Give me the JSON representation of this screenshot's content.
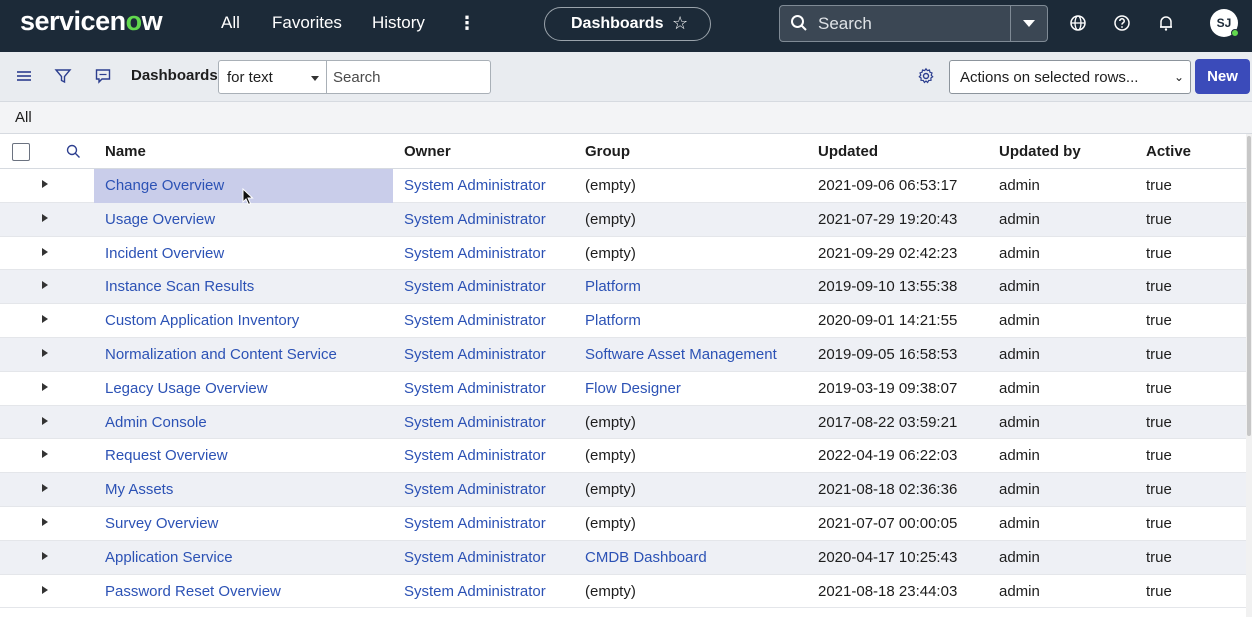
{
  "topnav": {
    "logo_pre": "servicen",
    "logo_o": "o",
    "logo_post": "w",
    "links": [
      "All",
      "Favorites",
      "History"
    ],
    "context_title": "Dashboards",
    "search_placeholder": "Search",
    "avatar_initials": "SJ"
  },
  "toolbar": {
    "list_title": "Dashboards",
    "search_field": "for text",
    "search_placeholder": "Search",
    "actions_label": "Actions on selected rows...",
    "new_label": "New"
  },
  "breadcrumb": "All",
  "table": {
    "columns": [
      "Name",
      "Owner",
      "Group",
      "Updated",
      "Updated by",
      "Active"
    ],
    "rows": [
      {
        "name": "Change Overview",
        "owner": "System Administrator",
        "group": "(empty)",
        "updated": "2021-09-06 06:53:17",
        "updated_by": "admin",
        "active": "true"
      },
      {
        "name": "Usage Overview",
        "owner": "System Administrator",
        "group": "(empty)",
        "updated": "2021-07-29 19:20:43",
        "updated_by": "admin",
        "active": "true"
      },
      {
        "name": "Incident Overview",
        "owner": "System Administrator",
        "group": "(empty)",
        "updated": "2021-09-29 02:42:23",
        "updated_by": "admin",
        "active": "true"
      },
      {
        "name": "Instance Scan Results",
        "owner": "System Administrator",
        "group": "Platform",
        "updated": "2019-09-10 13:55:38",
        "updated_by": "admin",
        "active": "true"
      },
      {
        "name": "Custom Application Inventory",
        "owner": "System Administrator",
        "group": "Platform",
        "updated": "2020-09-01 14:21:55",
        "updated_by": "admin",
        "active": "true"
      },
      {
        "name": "Normalization and Content Service",
        "owner": "System Administrator",
        "group": "Software Asset Management",
        "updated": "2019-09-05 16:58:53",
        "updated_by": "admin",
        "active": "true"
      },
      {
        "name": "Legacy Usage Overview",
        "owner": "System Administrator",
        "group": "Flow Designer",
        "updated": "2019-03-19 09:38:07",
        "updated_by": "admin",
        "active": "true"
      },
      {
        "name": "Admin Console",
        "owner": "System Administrator",
        "group": "(empty)",
        "updated": "2017-08-22 03:59:21",
        "updated_by": "admin",
        "active": "true"
      },
      {
        "name": "Request Overview",
        "owner": "System Administrator",
        "group": "(empty)",
        "updated": "2022-04-19 06:22:03",
        "updated_by": "admin",
        "active": "true"
      },
      {
        "name": "My Assets",
        "owner": "System Administrator",
        "group": "(empty)",
        "updated": "2021-08-18 02:36:36",
        "updated_by": "admin",
        "active": "true"
      },
      {
        "name": "Survey Overview",
        "owner": "System Administrator",
        "group": "(empty)",
        "updated": "2021-07-07 00:00:05",
        "updated_by": "admin",
        "active": "true"
      },
      {
        "name": "Application Service",
        "owner": "System Administrator",
        "group": "CMDB Dashboard",
        "updated": "2020-04-17 10:25:43",
        "updated_by": "admin",
        "active": "true"
      },
      {
        "name": "Password Reset Overview",
        "owner": "System Administrator",
        "group": "(empty)",
        "updated": "2021-08-18 23:44:03",
        "updated_by": "admin",
        "active": "true"
      }
    ]
  },
  "colors": {
    "nav_bg": "#1c2a38",
    "link": "#2c52b5",
    "primary_button": "#3b4bba",
    "row_alt": "#eef0f5",
    "row_hover": "#c9cdea"
  }
}
